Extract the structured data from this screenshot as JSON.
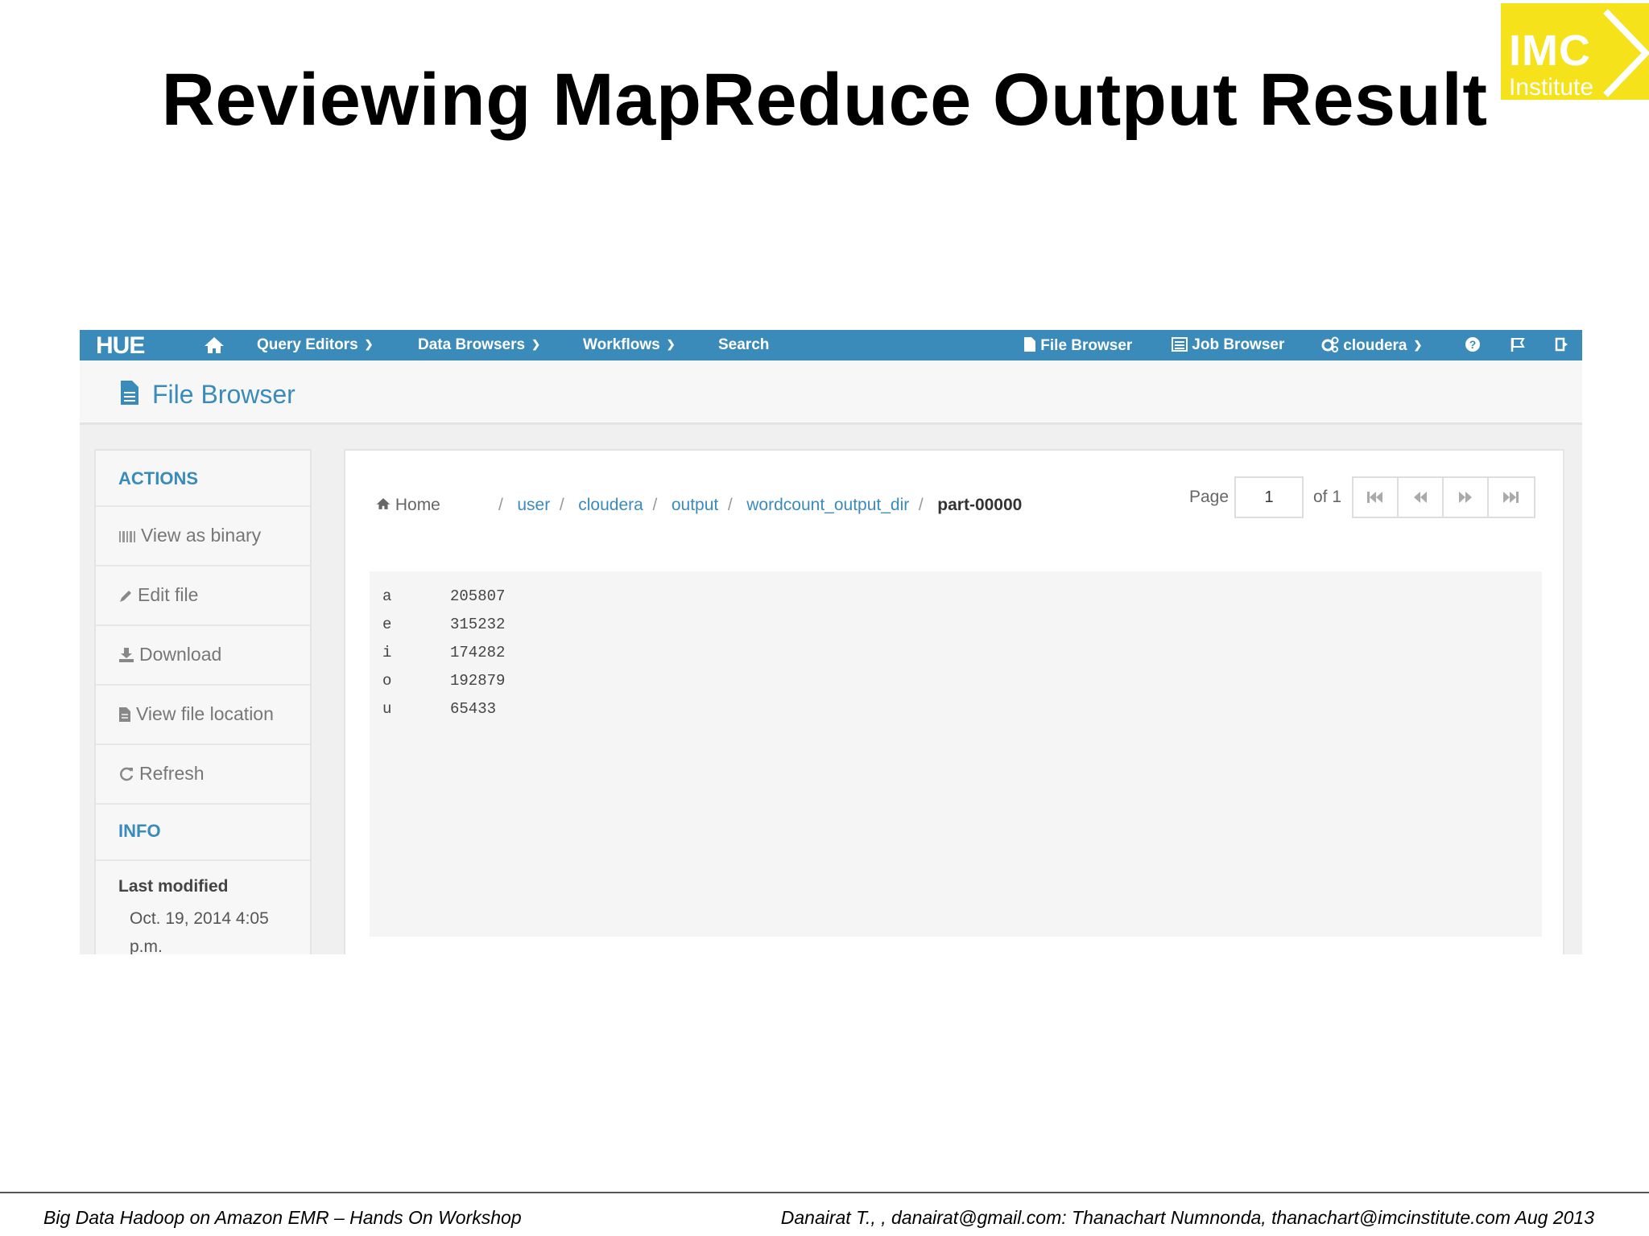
{
  "slide": {
    "title": "Reviewing MapReduce Output Result",
    "logo": {
      "line1": "IMC",
      "line2": "Institute",
      "color": "#f5e21a"
    },
    "footer_left": "Big Data Hadoop on Amazon EMR – Hands On Workshop",
    "footer_right": "Danairat T., , danairat@gmail.com:  Thanachart Numnonda,  thanachart@imcinstitute.com   Aug 2013"
  },
  "navbar": {
    "brand": "HUE",
    "home_icon": "home-icon",
    "items": [
      {
        "label": "Query Editors",
        "has_caret": true
      },
      {
        "label": "Data Browsers",
        "has_caret": true
      },
      {
        "label": "Workflows",
        "has_caret": true
      },
      {
        "label": "Search",
        "has_caret": false
      }
    ],
    "right_items": [
      {
        "label": "File Browser",
        "icon": "file-icon"
      },
      {
        "label": "Job Browser",
        "icon": "list-icon"
      },
      {
        "label": "cloudera",
        "icon": "gears-icon",
        "has_caret": true
      }
    ],
    "color": "#3b8bba"
  },
  "page_header": {
    "title": "File Browser",
    "icon": "file-icon"
  },
  "sidebar": {
    "actions_heading": "ACTIONS",
    "actions": [
      {
        "label": "View as binary",
        "icon": "barcode-icon"
      },
      {
        "label": "Edit file",
        "icon": "pencil-icon"
      },
      {
        "label": "Download",
        "icon": "download-icon"
      },
      {
        "label": "View file location",
        "icon": "file-icon"
      },
      {
        "label": "Refresh",
        "icon": "refresh-icon"
      }
    ],
    "info_heading": "INFO",
    "last_modified_label": "Last modified",
    "last_modified_value": "Oct. 19, 2014 4:05 p.m."
  },
  "breadcrumb": {
    "home": "Home",
    "path": [
      "user",
      "cloudera",
      "output",
      "wordcount_output_dir"
    ],
    "current": "part-00000"
  },
  "pager": {
    "label": "Page",
    "value": "1",
    "of": "of 1"
  },
  "file_content": [
    {
      "key": "a",
      "value": "205807"
    },
    {
      "key": "e",
      "value": "315232"
    },
    {
      "key": "i",
      "value": "174282"
    },
    {
      "key": "o",
      "value": "192879"
    },
    {
      "key": "u",
      "value": "65433"
    }
  ]
}
